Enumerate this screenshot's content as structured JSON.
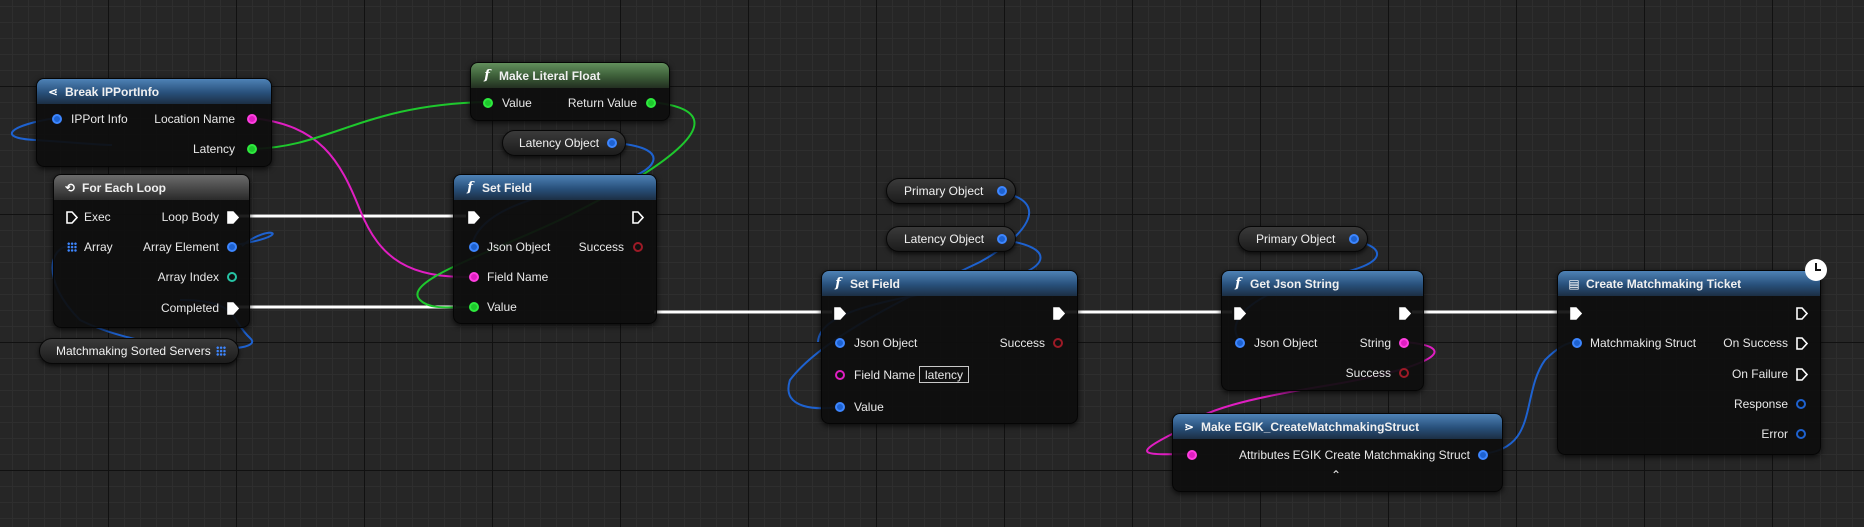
{
  "nodes": {
    "break_ipportinfo": {
      "title": "Break IPPortInfo",
      "in_ipport_info": "IPPort Info",
      "out_location_name": "Location Name",
      "out_latency": "Latency"
    },
    "make_literal_float": {
      "title": "Make Literal Float",
      "in_value": "Value",
      "out_return_value": "Return Value"
    },
    "for_each_loop": {
      "title": "For Each Loop",
      "in_exec": "Exec",
      "in_array": "Array",
      "out_loop_body": "Loop Body",
      "out_array_element": "Array Element",
      "out_array_index": "Array Index",
      "out_completed": "Completed"
    },
    "set_field_1": {
      "title": "Set Field",
      "in_json_object": "Json Object",
      "in_field_name": "Field Name",
      "in_value": "Value",
      "out_success": "Success"
    },
    "set_field_2": {
      "title": "Set Field",
      "in_json_object": "Json Object",
      "in_field_name": "Field Name",
      "field_name_value": "latency",
      "in_value": "Value",
      "out_success": "Success"
    },
    "get_json_string": {
      "title": "Get Json String",
      "in_json_object": "Json Object",
      "out_string": "String",
      "out_success": "Success"
    },
    "make_egik_struct": {
      "title": "Make EGIK_CreateMatchmakingStruct",
      "in_attributes": "Attributes",
      "out_struct": "EGIK Create Matchmaking Struct"
    },
    "create_matchmaking_ticket": {
      "title": "Create Matchmaking Ticket",
      "in_struct": "Matchmaking Struct",
      "out_on_success": "On Success",
      "out_on_failure": "On Failure",
      "out_response": "Response",
      "out_error": "Error"
    }
  },
  "variables": {
    "latency_object_1": "Latency Object",
    "matchmaking_sorted_servers": "Matchmaking Sorted Servers",
    "primary_object_1": "Primary Object",
    "latency_object_2": "Latency Object",
    "primary_object_2": "Primary Object"
  },
  "colors": {
    "exec": "#ffffff",
    "object_pin": "#1e62d0",
    "string_pin": "#e01ec2",
    "float_pin": "#1ec82d",
    "bool_pin": "#9d1a26",
    "int_pin": "#26c4a4",
    "function_header": "#28507b",
    "pure_header": "#3b5c37"
  }
}
